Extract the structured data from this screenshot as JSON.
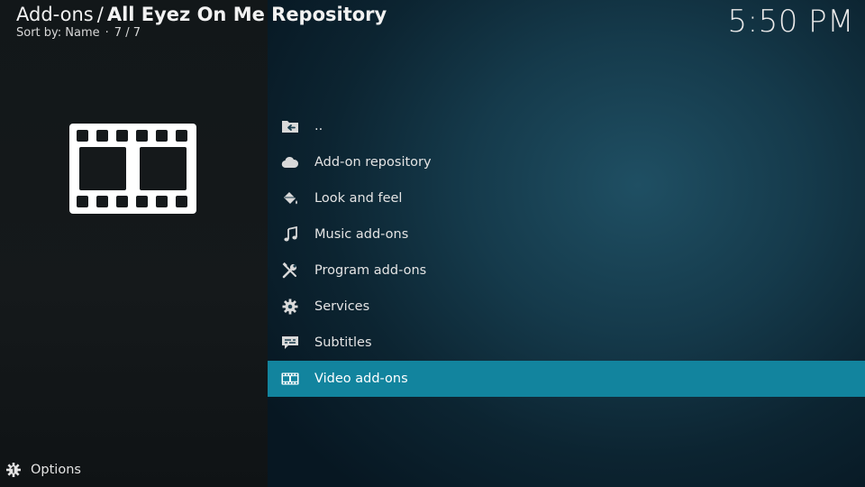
{
  "header": {
    "breadcrumb_root": "Add-ons",
    "breadcrumb_separator": "/",
    "breadcrumb_current": "All Eyez On Me Repository",
    "sort_label": "Sort by: Name",
    "sort_separator": "·",
    "item_count": "7 / 7"
  },
  "clock": "5:50 PM",
  "thumbnail": {
    "icon": "film-strip-icon"
  },
  "list": {
    "items": [
      {
        "label": "..",
        "icon": "parent-folder-icon"
      },
      {
        "label": "Add-on repository",
        "icon": "cloud-icon"
      },
      {
        "label": "Look and feel",
        "icon": "paint-bucket-icon"
      },
      {
        "label": "Music add-ons",
        "icon": "music-note-icon"
      },
      {
        "label": "Program add-ons",
        "icon": "tools-icon"
      },
      {
        "label": "Services",
        "icon": "gear-icon"
      },
      {
        "label": "Subtitles",
        "icon": "subtitles-icon"
      },
      {
        "label": "Video add-ons",
        "icon": "film-icon"
      }
    ],
    "focused_index": 7
  },
  "footer": {
    "options_label": "Options",
    "options_icon": "options-gear-icon"
  },
  "colors": {
    "focus_highlight": "#12849e",
    "left_panel": "#15191b",
    "right_panel": "#153a4b",
    "text": "#e4e4e4"
  }
}
